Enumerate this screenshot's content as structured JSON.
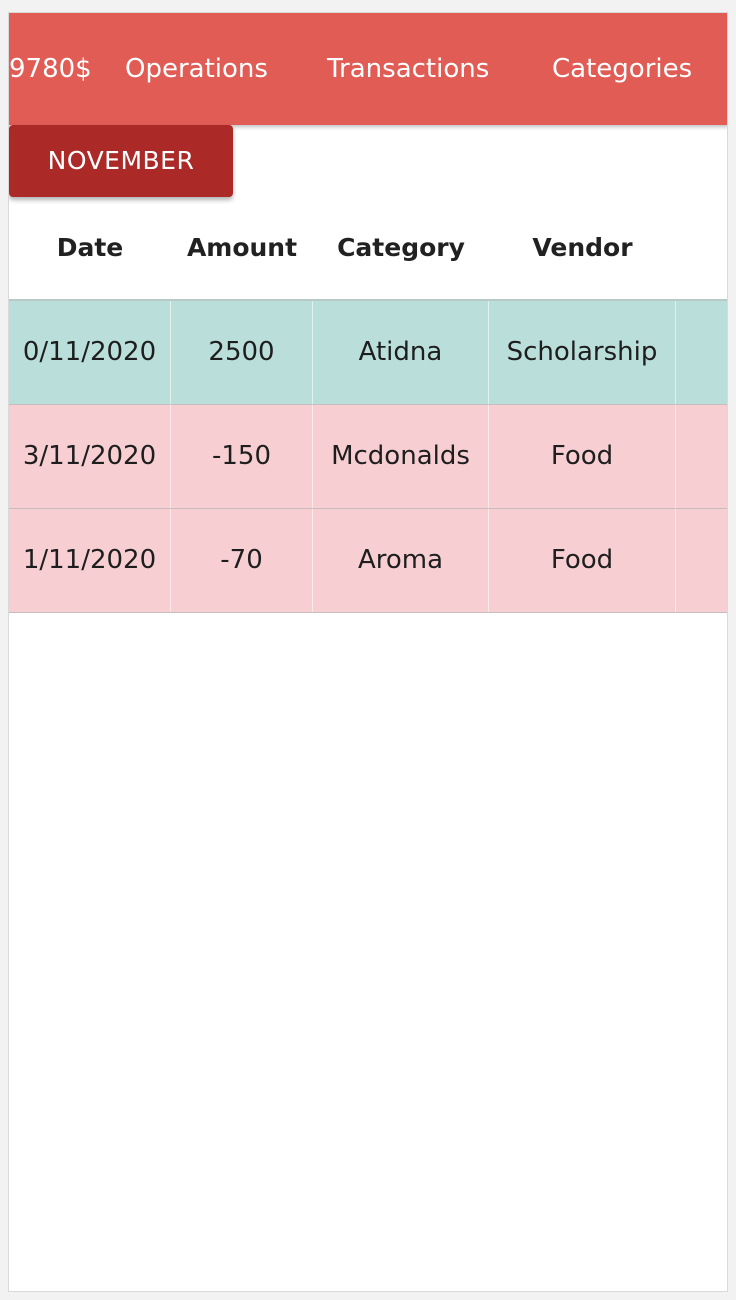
{
  "navbar": {
    "balance": "9780$",
    "links": [
      "Operations",
      "Transactions",
      "Categories"
    ]
  },
  "month_button": {
    "label": "NOVEMBER"
  },
  "table": {
    "headers": [
      "Date",
      "Amount",
      "Category",
      "Vendor"
    ],
    "rows": [
      {
        "date": "0/11/2020",
        "amount": "2500",
        "category": "Atidna",
        "vendor": "Scholarship",
        "type": "income"
      },
      {
        "date": "3/11/2020",
        "amount": "-150",
        "category": "Mcdonalds",
        "vendor": "Food",
        "type": "expense"
      },
      {
        "date": "1/11/2020",
        "amount": "-70",
        "category": "Aroma",
        "vendor": "Food",
        "type": "expense"
      }
    ],
    "row_action_icon": "trash-icon"
  },
  "colors": {
    "navbar": "#e05c55",
    "month_button": "#ab2a27",
    "income_row": "#badfda",
    "expense_row": "#f7cfd3"
  }
}
